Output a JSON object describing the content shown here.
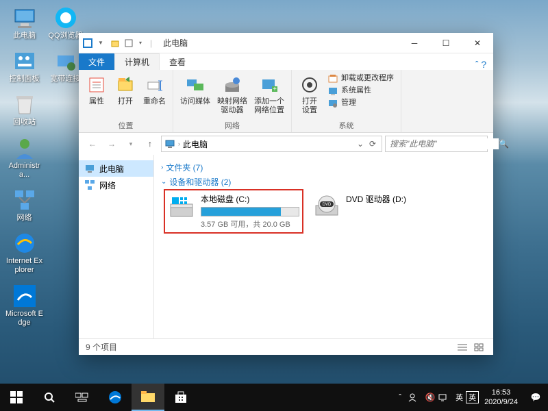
{
  "desktop_icons_col1": [
    {
      "label": "此电脑",
      "icon": "pc"
    },
    {
      "label": "控制面板",
      "icon": "cpl"
    },
    {
      "label": "回收站",
      "icon": "bin"
    },
    {
      "label": "Administra...",
      "icon": "user"
    },
    {
      "label": "网络",
      "icon": "net"
    },
    {
      "label": "Internet Explorer",
      "icon": "ie"
    },
    {
      "label": "Microsoft Edge",
      "icon": "edge"
    }
  ],
  "desktop_icons_col2": [
    {
      "label": "QQ浏览器",
      "icon": "qq"
    },
    {
      "label": "宽带连接",
      "icon": "dial"
    }
  ],
  "window": {
    "title": "此电脑",
    "tabs": {
      "file": "文件",
      "active": "计算机",
      "view": "查看"
    },
    "ribbon": {
      "group_location": {
        "label": "位置",
        "buttons": [
          {
            "label": "属性",
            "icon": "props"
          },
          {
            "label": "打开",
            "icon": "open"
          },
          {
            "label": "重命名",
            "icon": "rename"
          }
        ]
      },
      "group_network": {
        "label": "网络",
        "buttons": [
          {
            "label": "访问媒体",
            "icon": "media"
          },
          {
            "label": "映射网络\n驱动器",
            "icon": "mapnet"
          },
          {
            "label": "添加一个\n网络位置",
            "icon": "addnet"
          }
        ]
      },
      "group_system": {
        "label": "系统",
        "open": "打开\n设置",
        "items": [
          {
            "label": "卸载或更改程序",
            "icon": "uninst"
          },
          {
            "label": "系统属性",
            "icon": "sysprops"
          },
          {
            "label": "管理",
            "icon": "manage"
          }
        ]
      }
    },
    "address": {
      "location": "此电脑"
    },
    "search": {
      "placeholder": "搜索\"此电脑\""
    },
    "nav": [
      {
        "label": "此电脑",
        "icon": "pc",
        "selected": true
      },
      {
        "label": "网络",
        "icon": "net",
        "selected": false
      }
    ],
    "content": {
      "folder_group": "文件夹 (7)",
      "drive_group": "设备和驱动器 (2)",
      "drives": [
        {
          "name": "本地磁盘 (C:)",
          "free": "3.57 GB 可用，共 20.0 GB",
          "fill_pct": 82,
          "icon": "hdd",
          "highlight": true
        },
        {
          "name": "DVD 驱动器 (D:)",
          "icon": "dvd",
          "highlight": false
        }
      ]
    },
    "status": {
      "count": "9 个项目"
    }
  },
  "taskbar": {
    "tray": {
      "ime1": "英",
      "ime2": "英",
      "time": "16:53",
      "date": "2020/9/24"
    }
  }
}
